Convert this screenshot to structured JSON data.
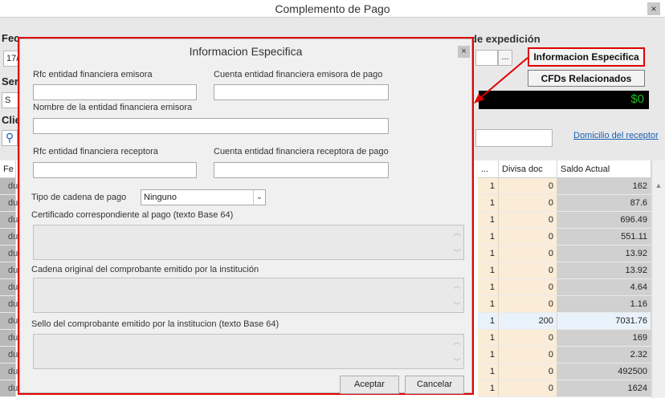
{
  "window": {
    "title": "Complemento de Pago",
    "close_glyph": "×"
  },
  "background": {
    "labels": {
      "fecha": "Fec",
      "serie": "Ser",
      "cliente": "Clie",
      "fecha_val": "17/",
      "serie_val": "S",
      "expedicion": "de expedición"
    },
    "browse_btn": "...",
    "buttons": {
      "info_esp": "Informacion Especifica",
      "cfds": "CFDs Relacionados"
    },
    "total": "$0",
    "domicilio_link": "Domicilio del receptor",
    "grid": {
      "headers": {
        "col0": "Fe",
        "col_dots": "...",
        "col_divisa": "Divisa doc",
        "col_saldo": "Saldo Actual"
      },
      "rows": [
        {
          "left": "du",
          "num": "1",
          "divisa": "0",
          "saldo": "162"
        },
        {
          "left": "du",
          "num": "1",
          "divisa": "0",
          "saldo": "87.6"
        },
        {
          "left": "du",
          "num": "1",
          "divisa": "0",
          "saldo": "696.49"
        },
        {
          "left": "du",
          "num": "1",
          "divisa": "0",
          "saldo": "551.11"
        },
        {
          "left": "du",
          "num": "1",
          "divisa": "0",
          "saldo": "13.92"
        },
        {
          "left": "du",
          "num": "1",
          "divisa": "0",
          "saldo": "13.92"
        },
        {
          "left": "du",
          "num": "1",
          "divisa": "0",
          "saldo": "4.64"
        },
        {
          "left": "du",
          "num": "1",
          "divisa": "0",
          "saldo": "1.16"
        },
        {
          "left": "du",
          "num": "1",
          "divisa": "200",
          "saldo": "7031.76"
        },
        {
          "left": "du",
          "num": "1",
          "divisa": "0",
          "saldo": "169"
        },
        {
          "left": "du",
          "num": "1",
          "divisa": "0",
          "saldo": "2.32"
        },
        {
          "left": "du",
          "num": "1",
          "divisa": "0",
          "saldo": "492500"
        },
        {
          "left": "du",
          "num": "1",
          "divisa": "0",
          "saldo": "1624"
        }
      ]
    }
  },
  "dialog": {
    "title": "Informacion Especifica",
    "close_glyph": "×",
    "rfc_emisora_label": "Rfc entidad financiera emisora",
    "rfc_emisora_value": "",
    "cuenta_emisora_label": "Cuenta entidad financiera emisora de pago",
    "cuenta_emisora_value": "",
    "nombre_emisora_label": "Nombre de la entidad financiera emisora",
    "nombre_emisora_value": "",
    "rfc_receptora_label": "Rfc entidad financiera receptora",
    "rfc_receptora_value": "",
    "cuenta_receptora_label": "Cuenta entidad financiera receptora de pago",
    "cuenta_receptora_value": "",
    "tipo_cadena_label": "Tipo de cadena de pago",
    "tipo_cadena_value": "Ninguno",
    "certificado_label": "Certificado correspondiente al pago (texto Base 64)",
    "cadena_original_label": "Cadena original del comprobante emitido por la institución",
    "sello_label": "Sello del comprobante emitido por la institucion (texto Base 64)",
    "aceptar": "Aceptar",
    "cancelar": "Cancelar"
  },
  "colors": {
    "annotation_red": "#e00000",
    "total_green": "#1fbf1f",
    "link_blue": "#1a5fb4"
  }
}
